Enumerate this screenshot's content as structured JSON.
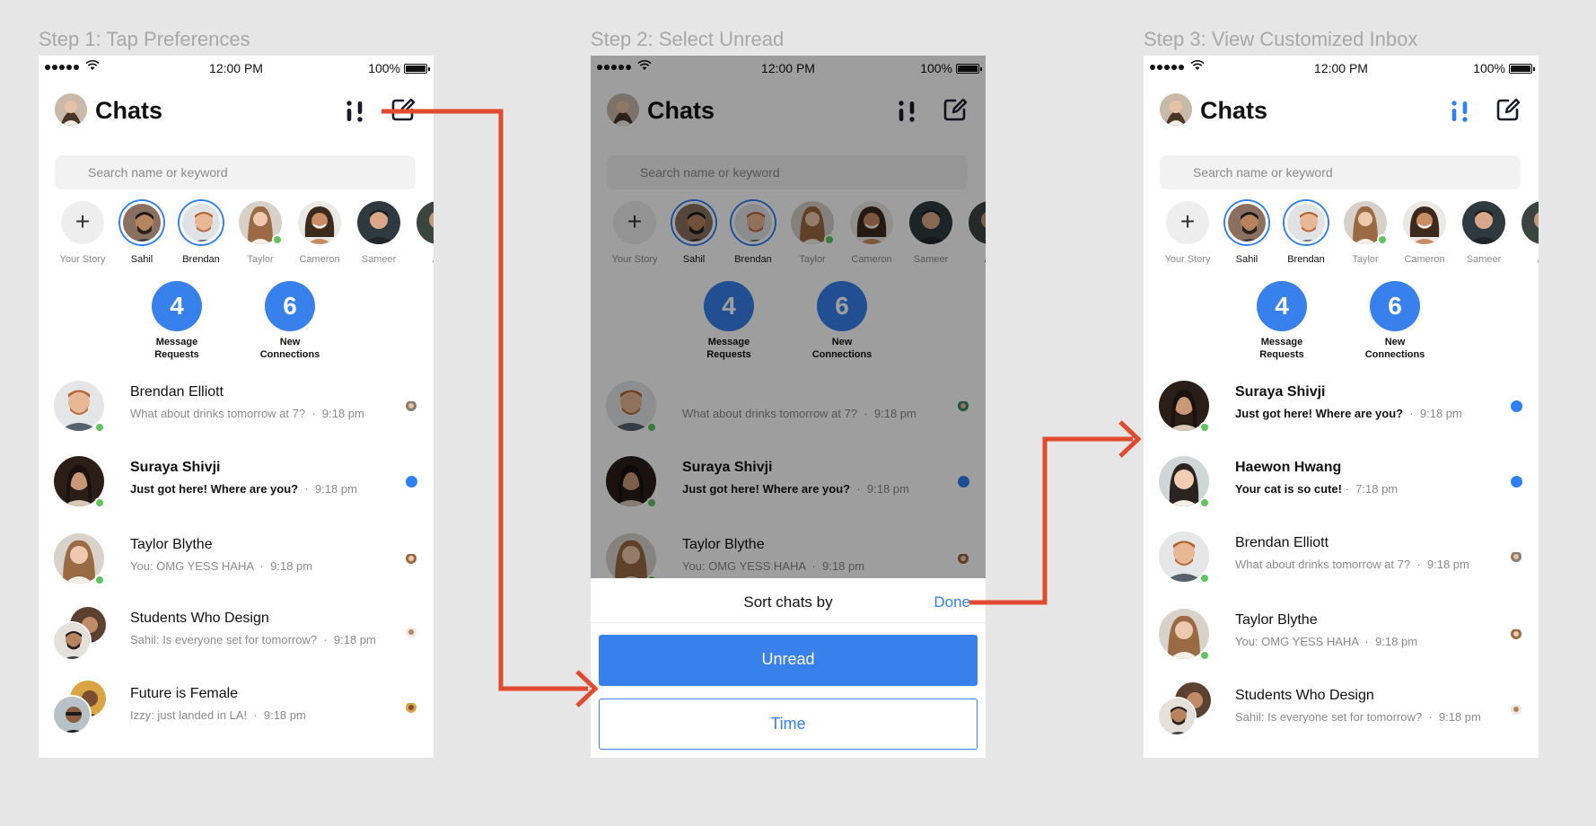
{
  "steps": [
    {
      "title": "Step 1: Tap Preferences"
    },
    {
      "title": "Step 2: Select Unread"
    },
    {
      "title": "Step 3: View Customized Inbox"
    }
  ],
  "status_bar": {
    "time": "12:00 PM",
    "battery": "100%"
  },
  "header": {
    "title": "Chats",
    "icons": [
      "preferences-icon",
      "compose-icon"
    ]
  },
  "search": {
    "placeholder": "Search name or keyword"
  },
  "stories": [
    {
      "name": "Your Story"
    },
    {
      "name": "Sahil"
    },
    {
      "name": "Brendan"
    },
    {
      "name": "Taylor"
    },
    {
      "name": "Cameron"
    },
    {
      "name": "Sameer"
    },
    {
      "name": "As"
    }
  ],
  "counters": [
    {
      "value": "4",
      "label": "Message\nRequests"
    },
    {
      "value": "6",
      "label": "New\nConnections"
    }
  ],
  "chats_step1": [
    {
      "name": "Brendan Elliott",
      "message": "What about drinks tomorrow at 7?",
      "time": "9:18 pm"
    },
    {
      "name": "Suraya Shivji",
      "message": "Just got here! Where are you?",
      "time": "9:18 pm"
    },
    {
      "name": "Taylor Blythe",
      "message": "You: OMG YESS HAHA",
      "time": "9:18 pm"
    },
    {
      "name": "Students Who Design",
      "message": "Sahil: Is everyone set for tomorrow?",
      "time": "9:18 pm"
    },
    {
      "name": "Future is Female",
      "message": "Izzy: just landed in LA!",
      "time": "9:18 pm"
    }
  ],
  "chats_step2": [
    {
      "name": "",
      "message": "What about drinks tomorrow at 7?",
      "time": "9:18 pm"
    },
    {
      "name": "Suraya Shivji",
      "message": "Just got here! Where are you?",
      "time": "9:18 pm"
    },
    {
      "name": "Taylor Blythe",
      "message": "You: OMG YESS HAHA",
      "time": "9:18 pm"
    }
  ],
  "sort_sheet": {
    "title": "Sort chats by",
    "done": "Done",
    "options": [
      "Unread",
      "Time"
    ]
  },
  "chats_step3": [
    {
      "name": "Suraya Shivji",
      "message": "Just got here! Where are you?",
      "time": "9:18 pm"
    },
    {
      "name": "Haewon Hwang",
      "message": "Your cat is so cute!",
      "time": "7:18 pm"
    },
    {
      "name": "Brendan Elliott",
      "message": "What about drinks tomorrow at 7?",
      "time": "9:18 pm"
    },
    {
      "name": "Taylor Blythe",
      "message": "You: OMG YESS HAHA",
      "time": "9:18 pm"
    },
    {
      "name": "Students Who Design",
      "message": "Sahil: Is everyone set for tomorrow?",
      "time": "9:18 pm"
    }
  ],
  "colors": {
    "accent": "#2f7ff5",
    "counter": "#3880ec",
    "online": "#5ec55e",
    "annotation": "#e04a2f",
    "background": "#e6e6e6"
  }
}
